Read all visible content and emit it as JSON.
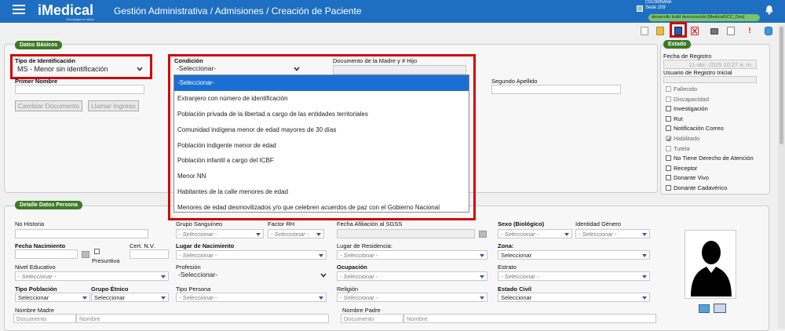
{
  "header": {
    "app_name": "iMedical",
    "tagline": "Tecnología en salud",
    "breadcrumb": "Gestión Administrativa / Admisiones / Creación de Paciente",
    "country": "COLOMBIANA",
    "site": "Sede 209",
    "env_badge": "desarrollo build desconocido [MedicalGCC_Dev]"
  },
  "datos_basicos": {
    "legend": "Datos Básicos",
    "tipo_id_label": "Tipo de Identificación",
    "tipo_id_value": "MS - Menor sin identificación",
    "condicion_label": "Condición",
    "condicion_value": "-Seleccionar-",
    "doc_madre_label": "Documento de la Madre y # Hijo",
    "primer_nombre_label": "Primer Nombre",
    "segundo_apellido_label": "Segundo Apellido",
    "cambiar_doc_label": "Cambiar Documento",
    "llamar_ingreso_label": "Llamar Ingreso"
  },
  "condicion_options": [
    "-Seleccionar-",
    "Extranjero con número de identificación",
    "Población privada de la libertad a cargo de las entidades territoriales",
    "Comunidad indígena menor de edad mayores de 30 días",
    "Población indigente menor de edad",
    "Población infantil a cargo del ICBF",
    "Menor NN",
    "Habitantes de la calle menores de edad",
    "Menores de edad desmovilizados y/o que celebren acuerdos de paz con el Gobierno Nacional"
  ],
  "estado": {
    "legend": "Estado",
    "fecha_registro_label": "Fecha de Registro",
    "fecha_registro_value": "11-abr.-2025 10:27 a. m.",
    "usuario_label": "Usuario de Registro Inicial",
    "checks": [
      {
        "label": "Fallecido",
        "checked": false,
        "disabled": true
      },
      {
        "label": "Discapacidad",
        "checked": false,
        "disabled": true
      },
      {
        "label": "Investigación",
        "checked": false,
        "disabled": false
      },
      {
        "label": "Rut",
        "checked": false,
        "disabled": false
      },
      {
        "label": "Notificación Correo",
        "checked": false,
        "disabled": false
      },
      {
        "label": "Habilitado",
        "checked": true,
        "disabled": true
      },
      {
        "label": "Tutela",
        "checked": false,
        "disabled": true
      },
      {
        "label": "No Tiene Derecho de Atención",
        "checked": false,
        "disabled": false
      },
      {
        "label": "Receptor",
        "checked": false,
        "disabled": false
      },
      {
        "label": "Donante Vivo",
        "checked": false,
        "disabled": false
      },
      {
        "label": "Donante Cadavérico",
        "checked": false,
        "disabled": false
      }
    ]
  },
  "detalle": {
    "legend": "Detalle Datos Persona",
    "no_historia": "No Historia",
    "grupo_sanguineo": "Grupo Sanguíneo",
    "factor_rh": "Factor RH",
    "fecha_afiliacion": "Fecha Afiliación al SGSS",
    "sexo": "Sexo (Biológico)",
    "identidad_genero": "Identidad Género",
    "fecha_nacimiento": "Fecha Nacimiento",
    "cert_nv": "Cert. N.V.",
    "presuntiva": "Presuntiva",
    "lugar_nacimiento": "Lugar de Nacimiento",
    "lugar_residencia": "Lugar de Residencia:",
    "zona": "Zona:",
    "nivel_educativo": "Nivel Educativo",
    "profesion": "Profesión",
    "ocupacion": "Ocupación",
    "estrato": "Estrato",
    "tipo_poblacion": "Tipo Población",
    "grupo_etnico": "Grupo Étnico",
    "tipo_persona": "Tipo Persona",
    "religion": "Religión",
    "estado_civil": "Estado Civil",
    "nombre_madre": "Nombre Madre",
    "nombre_padre": "Nombre Padre",
    "documento_ph": "Documento",
    "nombre_ph": "Nombre",
    "select_italic": "- Seleccionar -",
    "select_plain": "Seleccionar",
    "select_dash": "-Seleccionar-"
  }
}
